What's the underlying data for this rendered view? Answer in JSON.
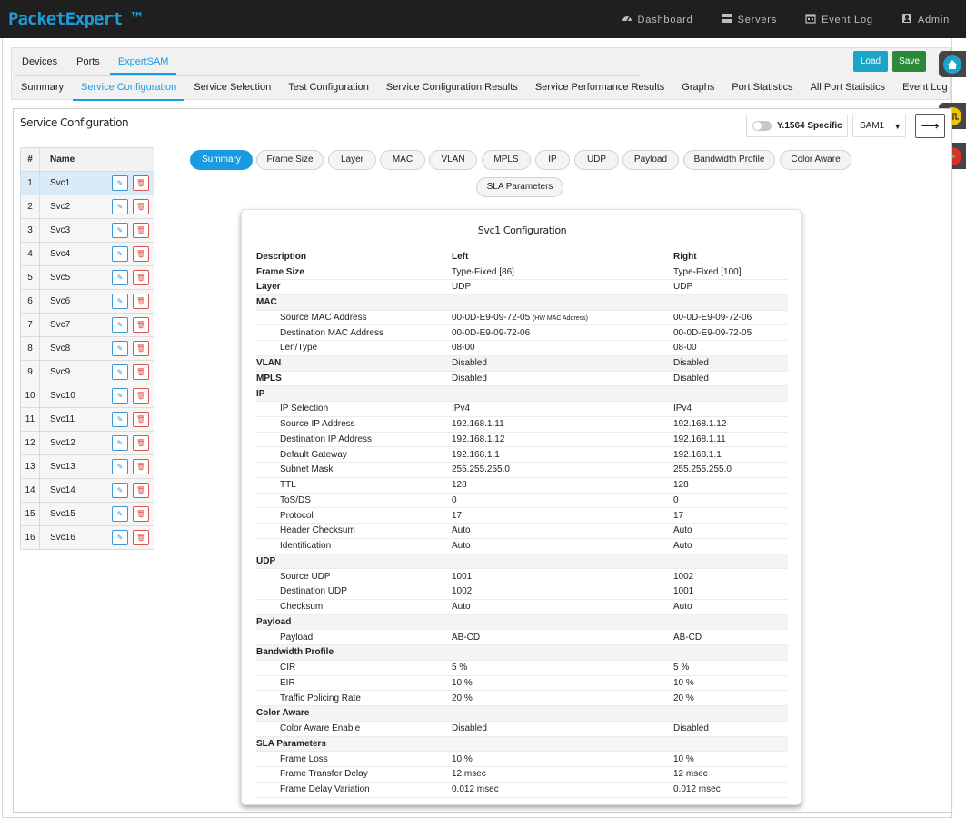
{
  "app": {
    "brand": "PacketExpert ™"
  },
  "topnav": [
    {
      "label": "Dashboard",
      "icon": "dashboard-icon"
    },
    {
      "label": "Servers",
      "icon": "servers-icon"
    },
    {
      "label": "Event Log",
      "icon": "calendar-icon"
    },
    {
      "label": "Admin",
      "icon": "user-icon"
    }
  ],
  "tabs_primary": [
    "Devices",
    "Ports",
    "ExpertSAM"
  ],
  "tabs_primary_active": "ExpertSAM",
  "tabs_secondary": [
    "Summary",
    "Service Configuration",
    "Service Selection",
    "Test Configuration",
    "Service Configuration Results",
    "Service Performance Results",
    "Graphs",
    "Port Statistics",
    "All Port Statistics",
    "Event Log"
  ],
  "tabs_secondary_active": "Service Configuration",
  "actions": {
    "load": "Load",
    "save": "Save"
  },
  "panel": {
    "title": "Service Configuration"
  },
  "controls": {
    "y1564_label": "Y.1564 Specific",
    "y1564_enabled": false,
    "sam_value": "SAM1",
    "arrow": "⟶"
  },
  "service_list": {
    "headers": {
      "num": "#",
      "name": "Name"
    },
    "selected": 1,
    "rows": [
      {
        "num": "1",
        "name": "Svc1"
      },
      {
        "num": "2",
        "name": "Svc2"
      },
      {
        "num": "3",
        "name": "Svc3"
      },
      {
        "num": "4",
        "name": "Svc4"
      },
      {
        "num": "5",
        "name": "Svc5"
      },
      {
        "num": "6",
        "name": "Svc6"
      },
      {
        "num": "7",
        "name": "Svc7"
      },
      {
        "num": "8",
        "name": "Svc8"
      },
      {
        "num": "9",
        "name": "Svc9"
      },
      {
        "num": "10",
        "name": "Svc10"
      },
      {
        "num": "11",
        "name": "Svc11"
      },
      {
        "num": "12",
        "name": "Svc12"
      },
      {
        "num": "13",
        "name": "Svc13"
      },
      {
        "num": "14",
        "name": "Svc14"
      },
      {
        "num": "15",
        "name": "Svc15"
      },
      {
        "num": "16",
        "name": "Svc16"
      }
    ]
  },
  "config_tabs": [
    "Summary",
    "Frame Size",
    "Layer",
    "MAC",
    "VLAN",
    "MPLS",
    "IP",
    "UDP",
    "Payload",
    "Bandwidth Profile",
    "Color Aware",
    "SLA Parameters"
  ],
  "config_tabs_active": "Summary",
  "config": {
    "title": "Svc1 Configuration",
    "headers": {
      "description": "Description",
      "left": "Left",
      "right": "Right"
    },
    "rows": [
      {
        "label": "Frame Size",
        "left": "Type-Fixed  [86]",
        "right": "Type-Fixed  [100]",
        "level": 0
      },
      {
        "label": "Layer",
        "left": "UDP",
        "right": "UDP",
        "level": 0
      },
      {
        "label": "MAC",
        "left": "",
        "right": "",
        "level": 0,
        "section": true
      },
      {
        "label": "Source MAC Address",
        "left": "00-0D-E9-09-72-05",
        "left_note": "(HW MAC Address)",
        "right": "00-0D-E9-09-72-06",
        "level": 1
      },
      {
        "label": "Destination MAC Address",
        "left": "00-0D-E9-09-72-06",
        "right": "00-0D-E9-09-72-05",
        "level": 1
      },
      {
        "label": "Len/Type",
        "left": "08-00",
        "right": "08-00",
        "level": 1
      },
      {
        "label": "VLAN",
        "left": "Disabled",
        "right": "Disabled",
        "level": 0,
        "section": true
      },
      {
        "label": "MPLS",
        "left": "Disabled",
        "right": "Disabled",
        "level": 0
      },
      {
        "label": "IP",
        "left": "",
        "right": "",
        "level": 0,
        "section": true
      },
      {
        "label": "IP Selection",
        "left": "IPv4",
        "right": "IPv4",
        "level": 1
      },
      {
        "label": "Source IP Address",
        "left": "192.168.1.11",
        "right": "192.168.1.12",
        "level": 1
      },
      {
        "label": "Destination IP Address",
        "left": "192.168.1.12",
        "right": "192.168.1.11",
        "level": 1
      },
      {
        "label": "Default Gateway",
        "left": "192.168.1.1",
        "right": "192.168.1.1",
        "level": 1
      },
      {
        "label": "Subnet Mask",
        "left": "255.255.255.0",
        "right": "255.255.255.0",
        "level": 1
      },
      {
        "label": "TTL",
        "left": "128",
        "right": "128",
        "level": 1
      },
      {
        "label": "ToS/DS",
        "left": "0",
        "right": "0",
        "level": 1
      },
      {
        "label": "Protocol",
        "left": "17",
        "right": "17",
        "level": 1
      },
      {
        "label": "Header Checksum",
        "left": "Auto",
        "right": "Auto",
        "level": 1
      },
      {
        "label": "Identification",
        "left": "Auto",
        "right": "Auto",
        "level": 1
      },
      {
        "label": "UDP",
        "left": "",
        "right": "",
        "level": 0,
        "section": true
      },
      {
        "label": "Source UDP",
        "left": "1001",
        "right": "1002",
        "level": 1
      },
      {
        "label": "Destination UDP",
        "left": "1002",
        "right": "1001",
        "level": 1
      },
      {
        "label": "Checksum",
        "left": "Auto",
        "right": "Auto",
        "level": 1
      },
      {
        "label": "Payload",
        "left": "",
        "right": "",
        "level": 0,
        "section": true
      },
      {
        "label": "Payload",
        "left": "AB-CD",
        "right": "AB-CD",
        "level": 1
      },
      {
        "label": "Bandwidth Profile",
        "left": "",
        "right": "",
        "level": 0,
        "section": true
      },
      {
        "label": "CIR",
        "left": "5  %",
        "right": "5  %",
        "level": 1
      },
      {
        "label": "EIR",
        "left": "10  %",
        "right": "10  %",
        "level": 1
      },
      {
        "label": "Traffic Policing Rate",
        "left": "20  %",
        "right": "20  %",
        "level": 1
      },
      {
        "label": "Color Aware",
        "left": "",
        "right": "",
        "level": 0,
        "section": true
      },
      {
        "label": "Color Aware Enable",
        "left": "Disabled",
        "right": "Disabled",
        "level": 1
      },
      {
        "label": "SLA Parameters",
        "left": "",
        "right": "",
        "level": 0,
        "section": true
      },
      {
        "label": "Frame Loss",
        "left": "10  %",
        "right": "10  %",
        "level": 1
      },
      {
        "label": "Frame Transfer Delay",
        "left": "12  msec",
        "right": "12  msec",
        "level": 1
      },
      {
        "label": "Frame Delay Variation",
        "left": "0.012  msec",
        "right": "0.012  msec",
        "level": 1
      }
    ]
  },
  "colors": {
    "accent": "#1a9be0",
    "load": "#1aa4c8",
    "save": "#2a8a3a",
    "topbar": "#1f1f1f",
    "brand": "#1e9ad6"
  }
}
